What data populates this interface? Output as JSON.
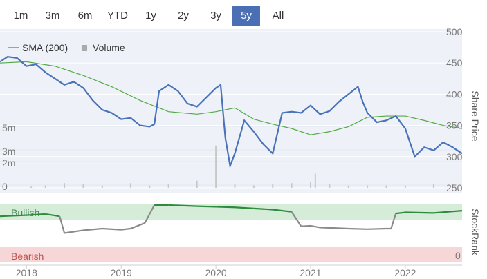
{
  "range_selector": {
    "buttons": [
      "1m",
      "3m",
      "6m",
      "YTD",
      "1y",
      "2y",
      "3y",
      "5y",
      "All"
    ],
    "active": "5y"
  },
  "legend": {
    "sma_label": "SMA (200)",
    "volume_label": "Volume"
  },
  "colors": {
    "price": "#4a72b8",
    "sma": "#55aa44",
    "volume": "#c8c8c8",
    "bullish_band": "#d4ecd8",
    "bearish_band": "#f6d6d6",
    "stockrank_bull": "#2e8b3e",
    "stockrank_neutral": "#8a8a8a"
  },
  "chart_data": {
    "type": "line",
    "x_ticks": [
      "2018",
      "2019",
      "2020",
      "2021",
      "2022"
    ],
    "y_right_label": "Share Price",
    "y_right_ticks": [
      "500",
      "450",
      "400",
      "350",
      "300",
      "250"
    ],
    "ylim_price": [
      250,
      500
    ],
    "volume_ticks": [
      "5m",
      "3m",
      "2m",
      "0"
    ],
    "series": [
      {
        "name": "Price",
        "x": [
          2017.72,
          2017.8,
          2017.9,
          2018.0,
          2018.1,
          2018.2,
          2018.3,
          2018.4,
          2018.5,
          2018.6,
          2018.7,
          2018.8,
          2018.9,
          2019.0,
          2019.1,
          2019.2,
          2019.3,
          2019.35,
          2019.4,
          2019.5,
          2019.6,
          2019.7,
          2019.8,
          2019.9,
          2020.0,
          2020.05,
          2020.1,
          2020.15,
          2020.2,
          2020.3,
          2020.4,
          2020.5,
          2020.6,
          2020.7,
          2020.8,
          2020.9,
          2021.0,
          2021.1,
          2021.2,
          2021.3,
          2021.4,
          2021.5,
          2021.55,
          2021.6,
          2021.7,
          2021.8,
          2021.9,
          2022.0,
          2022.1,
          2022.2,
          2022.3,
          2022.4,
          2022.5,
          2022.6
        ],
        "values": [
          452,
          460,
          458,
          445,
          448,
          435,
          425,
          415,
          420,
          410,
          390,
          375,
          370,
          360,
          362,
          350,
          348,
          352,
          405,
          415,
          405,
          385,
          380,
          395,
          410,
          415,
          330,
          285,
          305,
          358,
          340,
          320,
          305,
          370,
          372,
          370,
          382,
          368,
          373,
          388,
          400,
          412,
          388,
          370,
          355,
          358,
          365,
          345,
          300,
          315,
          310,
          323,
          315,
          305
        ]
      },
      {
        "name": "SMA (200)",
        "x": [
          2017.72,
          2018.0,
          2018.3,
          2018.6,
          2018.9,
          2019.2,
          2019.5,
          2019.8,
          2020.0,
          2020.2,
          2020.4,
          2020.6,
          2020.8,
          2021.0,
          2021.2,
          2021.4,
          2021.6,
          2021.8,
          2022.0,
          2022.2,
          2022.4,
          2022.6
        ],
        "values": [
          450,
          452,
          445,
          430,
          412,
          390,
          372,
          368,
          372,
          378,
          360,
          352,
          345,
          335,
          340,
          348,
          363,
          365,
          365,
          358,
          350,
          345
        ]
      },
      {
        "name": "Volume",
        "x": [
          2018.05,
          2018.2,
          2018.4,
          2018.6,
          2018.8,
          2019.1,
          2019.3,
          2019.5,
          2019.8,
          2020.0,
          2020.2,
          2020.4,
          2020.6,
          2020.8,
          2021.0,
          2021.05,
          2021.2,
          2021.4,
          2021.6,
          2021.8,
          2022.0,
          2022.3,
          2022.5
        ],
        "values": [
          0.1,
          0.2,
          0.4,
          0.3,
          0.2,
          0.4,
          0.2,
          0.3,
          0.6,
          3.6,
          0.3,
          0.2,
          0.3,
          0.4,
          0.5,
          1.2,
          0.3,
          0.2,
          0.2,
          0.2,
          0.2,
          0.3,
          0.3
        ]
      }
    ],
    "stockrank": {
      "title": "StockRank",
      "labels": [
        "Bullish",
        "Bearish",
        "0"
      ],
      "x": [
        2017.72,
        2018.0,
        2018.2,
        2018.35,
        2018.4,
        2018.6,
        2018.8,
        2019.0,
        2019.1,
        2019.25,
        2019.35,
        2019.5,
        2019.8,
        2020.0,
        2020.2,
        2020.4,
        2020.6,
        2020.8,
        2020.9,
        2021.0,
        2021.1,
        2021.4,
        2021.6,
        2021.8,
        2021.85,
        2021.9,
        2022.0,
        2022.3,
        2022.6
      ],
      "values": [
        80,
        82,
        84,
        80,
        50,
        55,
        58,
        56,
        58,
        68,
        100,
        100,
        98,
        97,
        96,
        94,
        92,
        88,
        62,
        63,
        60,
        58,
        57,
        58,
        58,
        85,
        87,
        86,
        90
      ],
      "bull_threshold": 70
    }
  }
}
